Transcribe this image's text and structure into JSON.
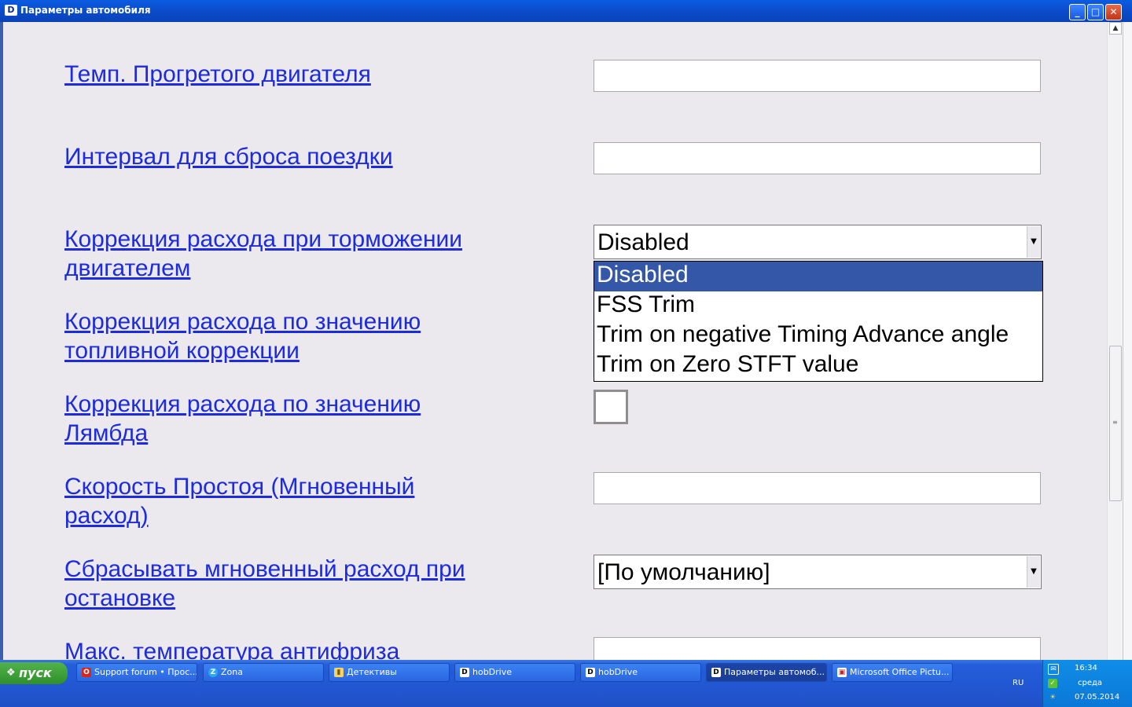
{
  "window": {
    "title": "Параметры автомобиля",
    "app_icon": "D"
  },
  "form": {
    "rows": [
      {
        "label": "Темп. Прогретого двигателя"
      },
      {
        "label": "Интервал для сброса поездки"
      },
      {
        "label": "Коррекция расхода при торможении двигателем"
      },
      {
        "label": "Коррекция расхода по значению топливной коррекции"
      },
      {
        "label": "Коррекция расхода по значению Лямбда"
      },
      {
        "label": "Скорость Простоя (Мгновенный расход)"
      },
      {
        "label": "Сбрасывать мгновенный расход при остановке"
      },
      {
        "label": "Макс. температура антифриза"
      }
    ],
    "fuel_cut_select": {
      "value": "Disabled",
      "options": [
        "Disabled",
        "FSS Trim",
        "Trim on negative Timing Advance angle",
        "Trim on Zero STFT value"
      ]
    },
    "idle_reset_select": {
      "value": "[По умолчанию]"
    }
  },
  "taskbar": {
    "start_label": "пуск",
    "tasks": [
      {
        "label": "Support forum • Прос...",
        "icon": "opera-icon"
      },
      {
        "label": "Zona",
        "icon": "zona-icon"
      },
      {
        "label": "Детективы",
        "icon": "folder-icon"
      },
      {
        "label": "hobDrive",
        "icon": "hobdrive-icon"
      },
      {
        "label": "hobDrive",
        "icon": "hobdrive-icon"
      },
      {
        "label": "Параметры автомоб...",
        "icon": "hobdrive-icon"
      },
      {
        "label": "Microsoft Office Pictu...",
        "icon": "picture-manager-icon"
      }
    ],
    "language": "RU",
    "time": "16:34",
    "day": "среда",
    "date": "07.05.2014"
  }
}
